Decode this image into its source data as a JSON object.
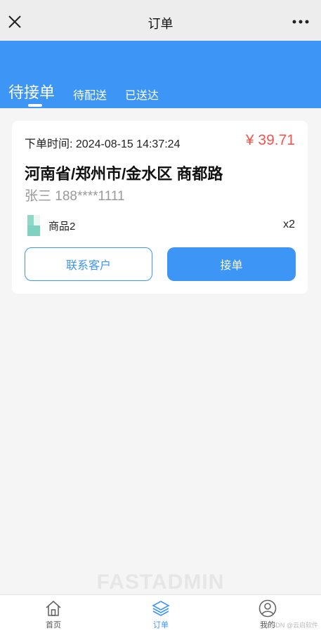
{
  "topbar": {
    "title": "订单",
    "close_icon": "close-icon",
    "more_icon": "more-icon"
  },
  "tabs": [
    {
      "label": "待接单",
      "active": true
    },
    {
      "label": "待配送",
      "active": false
    },
    {
      "label": "已送达",
      "active": false
    }
  ],
  "order": {
    "time_label": "下单时间: 2024-08-15 14:37:24",
    "price": "¥ 39.71",
    "address": "河南省/郑州市/金水区 商都路",
    "customer": "张三 188****1111",
    "product": {
      "name": "商品2",
      "qty": "x2"
    },
    "contact_button": "联系客户",
    "accept_button": "接单"
  },
  "watermark": "FASTADMIN",
  "bottom_nav": [
    {
      "label": "首页",
      "icon": "home-icon",
      "active": false
    },
    {
      "label": "订单",
      "icon": "layers-icon",
      "active": true
    },
    {
      "label": "我的",
      "icon": "user-icon",
      "active": false
    }
  ],
  "credit": "CSDN @云启软件",
  "colors": {
    "primary": "#3d95f5",
    "price": "#f0564d",
    "background": "#f5f5f5"
  }
}
